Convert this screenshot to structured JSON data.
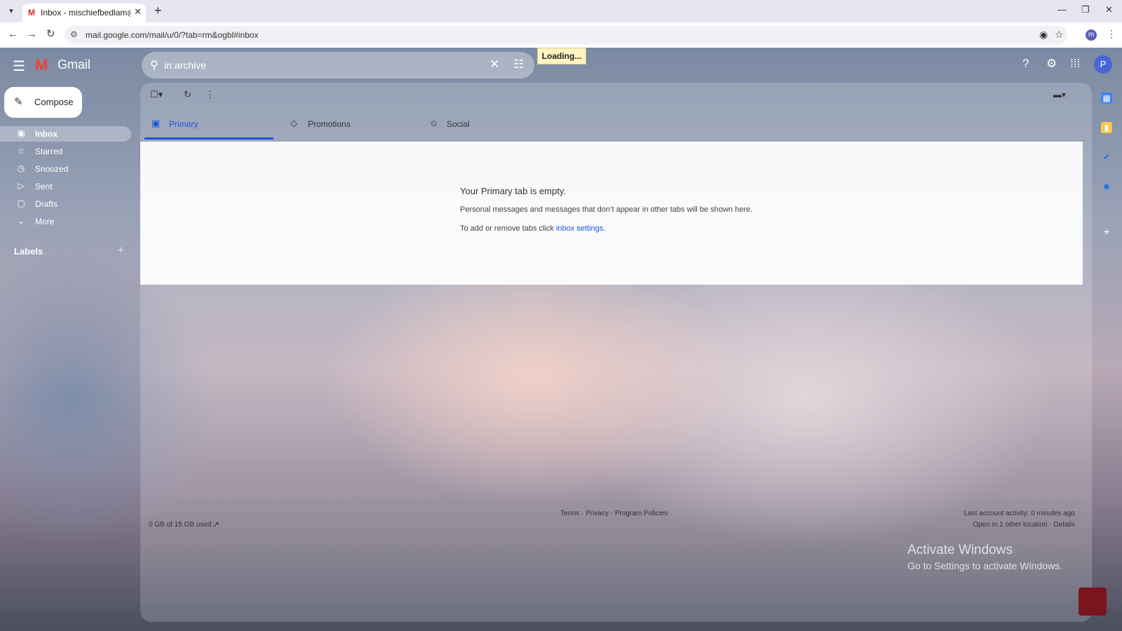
{
  "browser": {
    "tab_title": "Inbox - mischiefbedlam@gmail.com",
    "url": "mail.google.com/mail/u/0/?tab=rm&ogbl#inbox",
    "profile_initial": "m"
  },
  "gmail": {
    "logo_text": "Gmail",
    "search": {
      "value": "in:archive"
    },
    "loading_label": "Loading...",
    "avatar_initial": "P",
    "compose_label": "Compose",
    "nav": [
      {
        "label": "Inbox",
        "icon": "inbox-icon",
        "active": true
      },
      {
        "label": "Starred",
        "icon": "star-icon"
      },
      {
        "label": "Snoozed",
        "icon": "clock-icon"
      },
      {
        "label": "Sent",
        "icon": "send-icon"
      },
      {
        "label": "Drafts",
        "icon": "draft-icon"
      },
      {
        "label": "More",
        "icon": "chevron-down-icon"
      }
    ],
    "labels_heading": "Labels",
    "tabs": [
      {
        "label": "Primary",
        "icon": "inbox-icon",
        "selected": true
      },
      {
        "label": "Promotions",
        "icon": "tag-icon"
      },
      {
        "label": "Social",
        "icon": "people-icon"
      }
    ],
    "empty_state": {
      "title": "Your Primary tab is empty.",
      "line1": "Personal messages and messages that don’t appear in other tabs will be shown here.",
      "line2_prefix": "To add or remove tabs click ",
      "line2_link": "inbox settings",
      "line2_suffix": "."
    },
    "footer": {
      "storage": "0 GB of 15 GB used",
      "terms": "Terms",
      "privacy": "Privacy",
      "policies": "Program Policies",
      "separator": " · ",
      "activity": "Last account activity: 0 minutes ago",
      "other_location": "Open in 1 other location",
      "details": "Details"
    },
    "watermark": {
      "line1": "Activate Windows",
      "line2": "Go to Settings to activate Windows."
    },
    "accent_color": "#1a56db"
  }
}
